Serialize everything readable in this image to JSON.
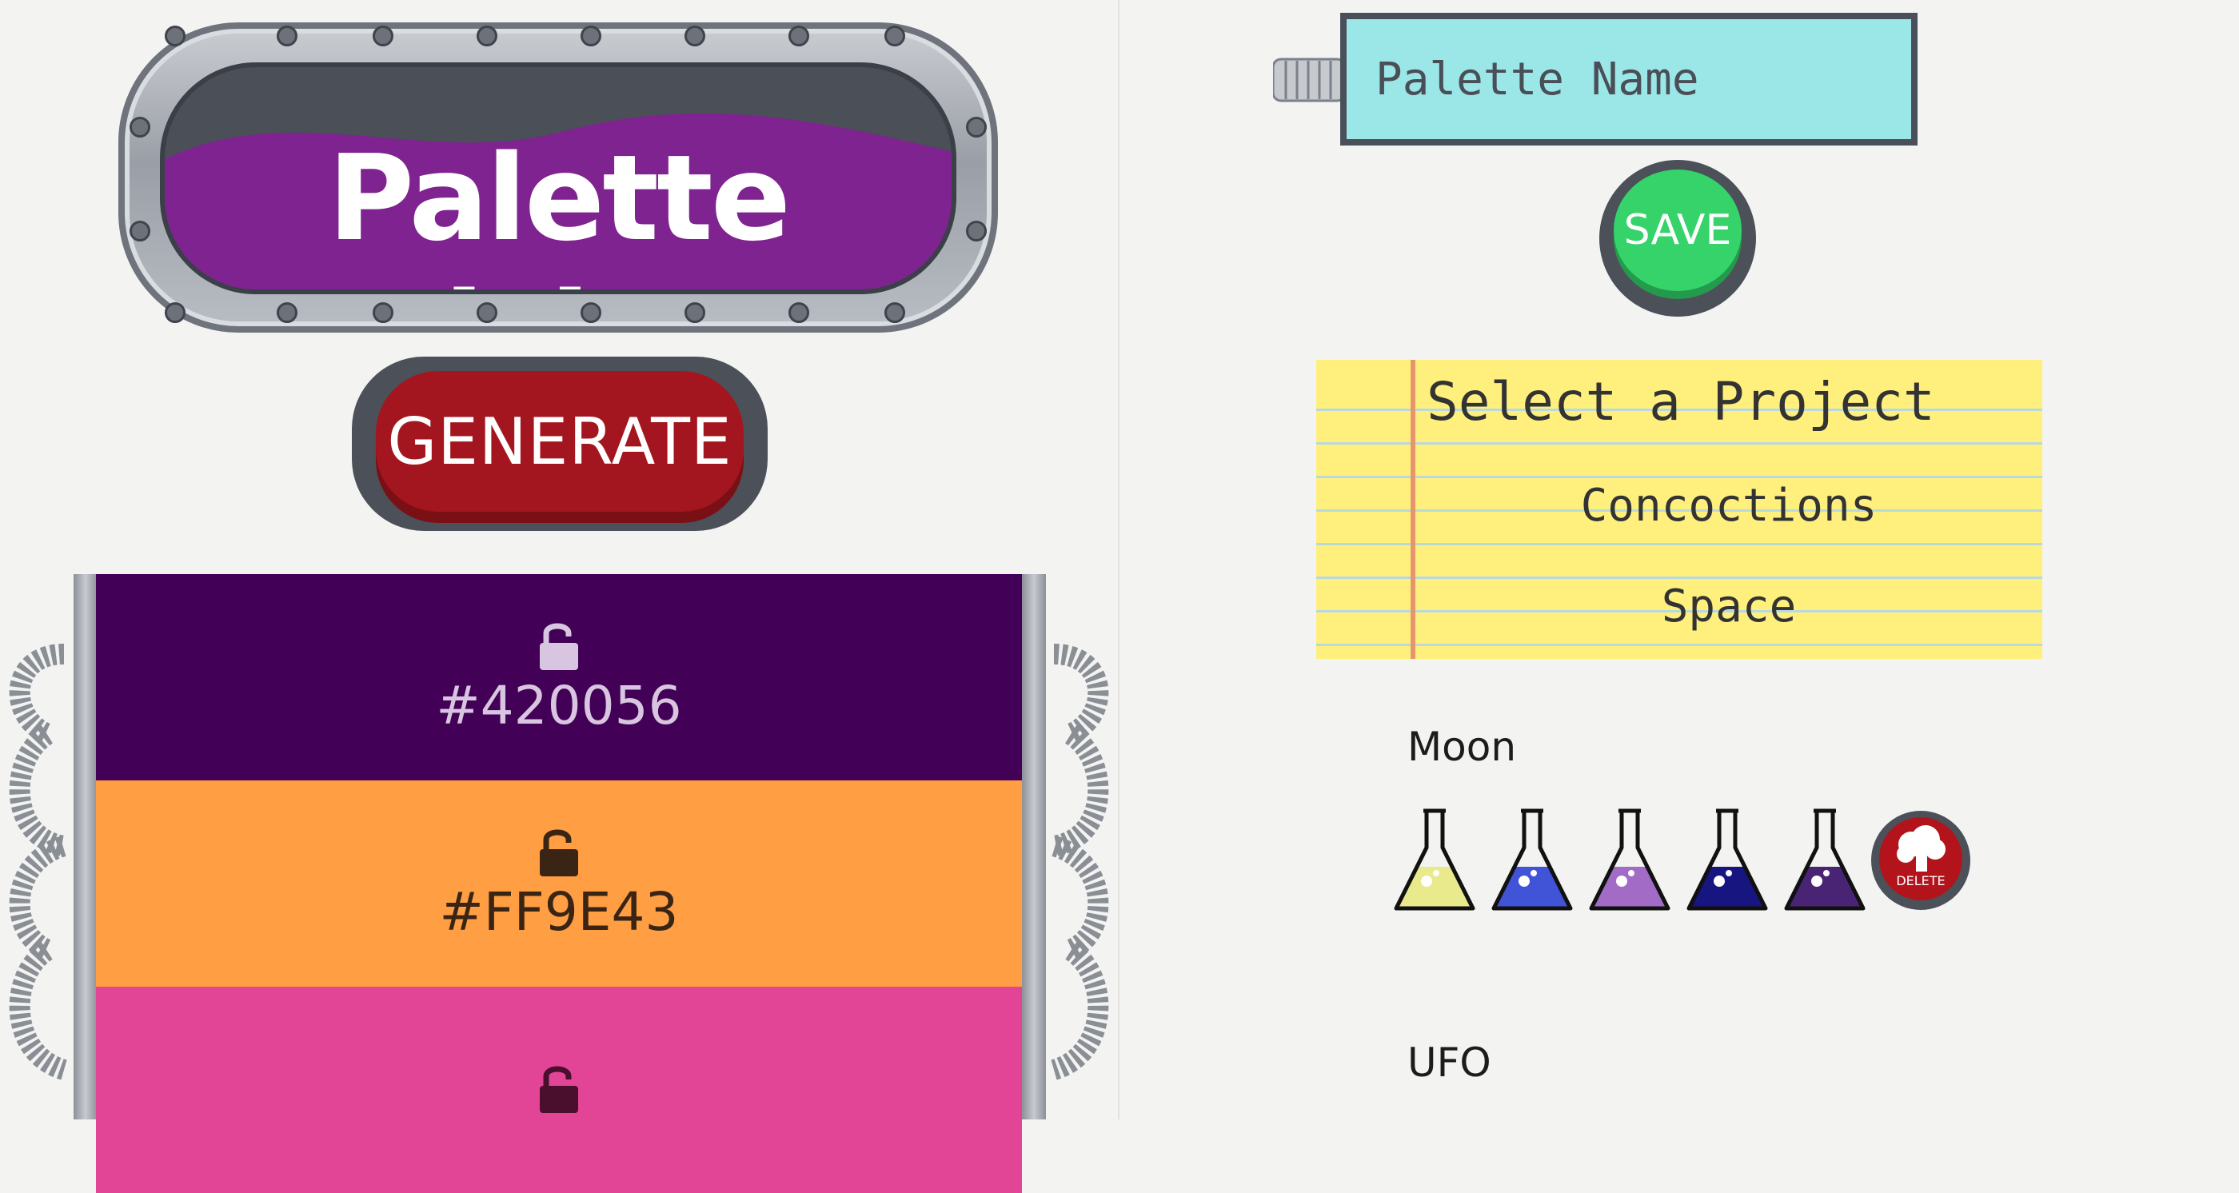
{
  "app": {
    "title": "Palette Picker"
  },
  "generate": {
    "label": "GENERATE"
  },
  "swatches": [
    {
      "hex": "#420056",
      "color": "#420056",
      "text_color": "#d8c5e0",
      "lock_icon": "unlock-icon"
    },
    {
      "hex": "#FF9E43",
      "color": "#FF9E43",
      "text_color": "#3a2414",
      "lock_icon": "unlock-icon"
    },
    {
      "hex": "",
      "color": "#E24595",
      "text_color": "#4a0f2c",
      "lock_icon": "unlock-icon"
    }
  ],
  "palette_name": {
    "placeholder": "Palette Name",
    "value": ""
  },
  "save": {
    "label": "SAVE"
  },
  "projects": {
    "title": "Select a Project",
    "items": [
      "Concoctions",
      "Space"
    ]
  },
  "saved_palettes": [
    {
      "name": "Moon",
      "flask_colors": [
        "#e9ea8b",
        "#4154d7",
        "#a16bc6",
        "#171580",
        "#4a2474"
      ],
      "delete_label": "DELETE"
    },
    {
      "name": "UFO",
      "flask_colors": []
    }
  ],
  "colors": {
    "title_purple": "#7f2390",
    "generate_red": "#a3161f",
    "save_green": "#35d36a",
    "input_cyan": "#9be7e7",
    "notepad_yellow": "#fff07d"
  }
}
